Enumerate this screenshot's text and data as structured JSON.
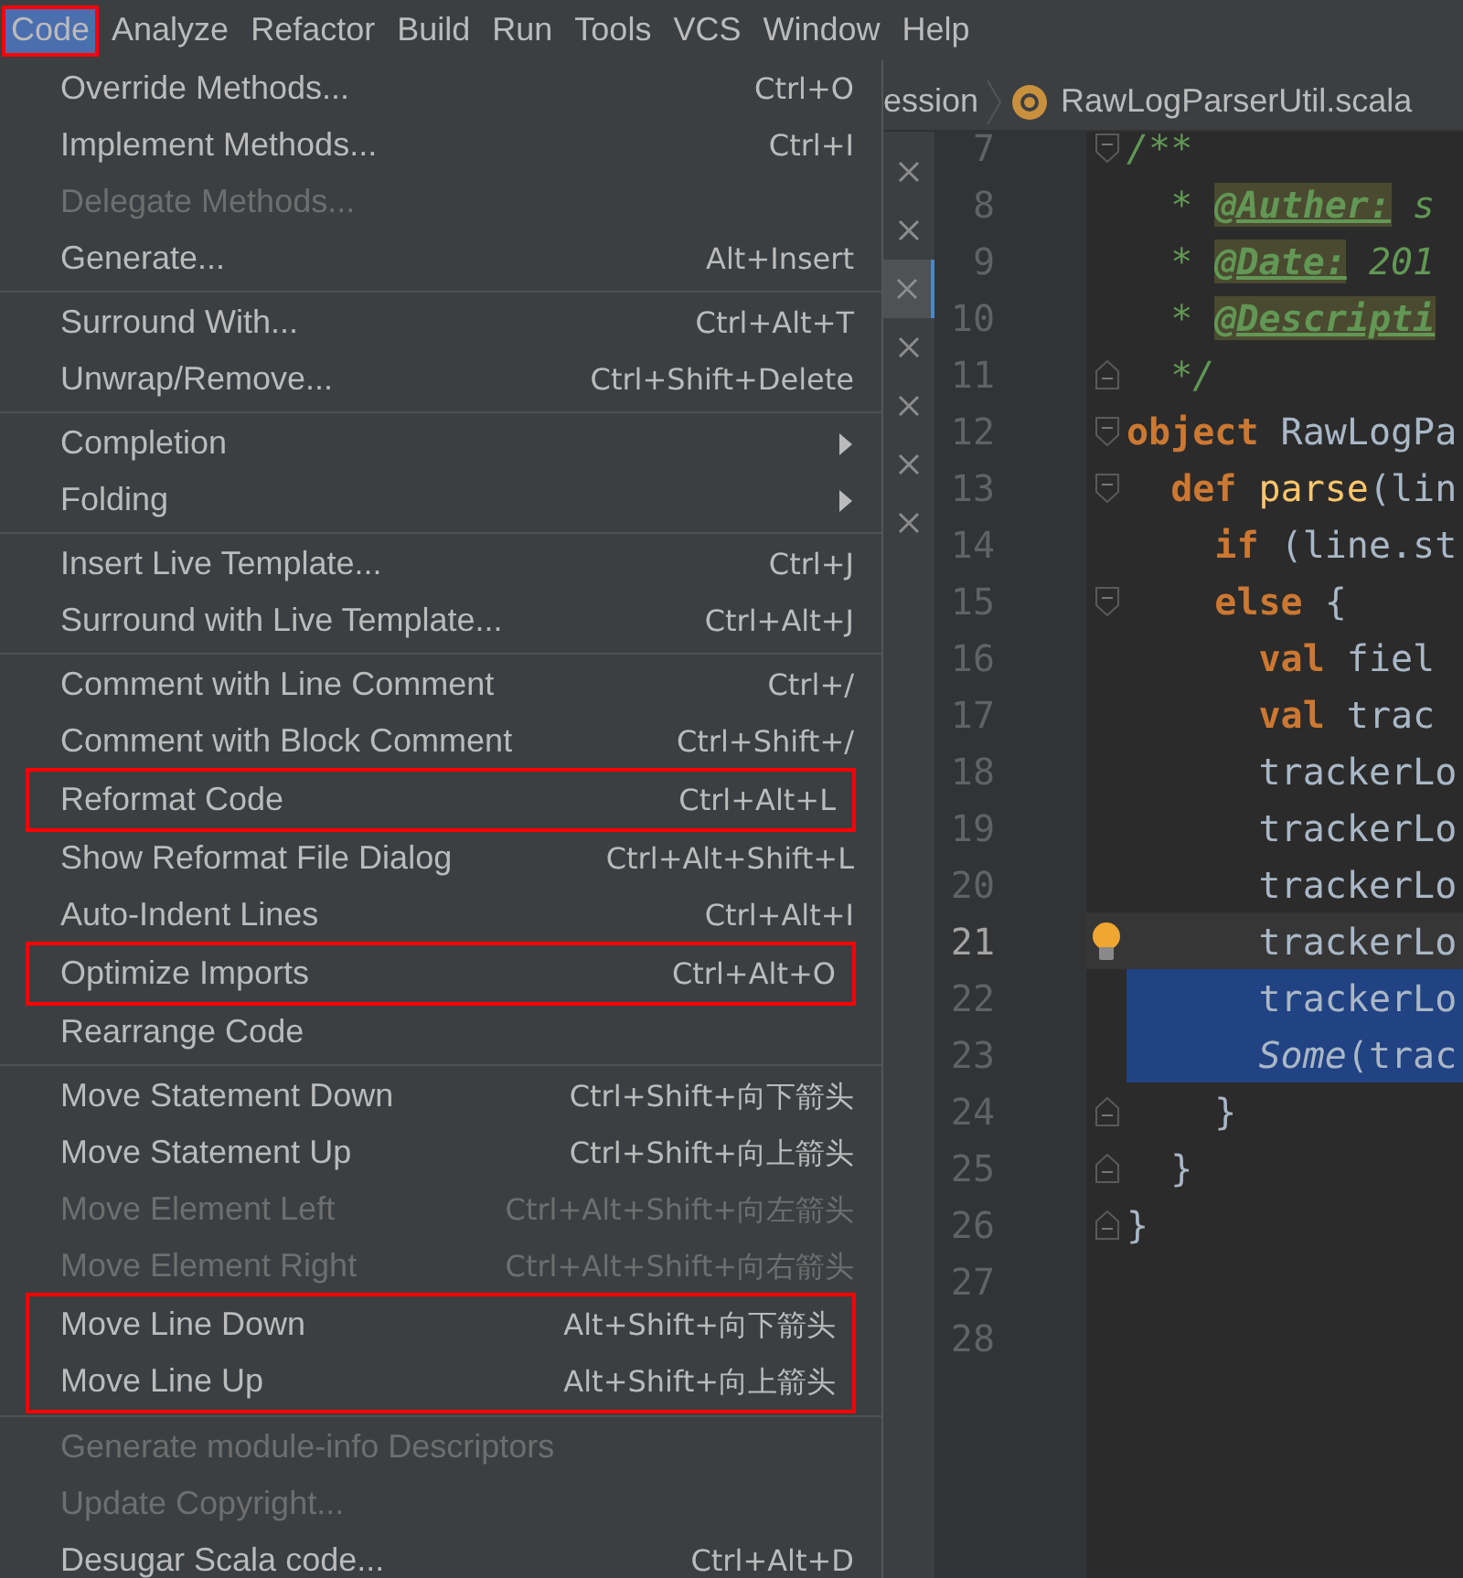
{
  "menubar": [
    {
      "label": "Code",
      "selected": true,
      "outlined": true
    },
    {
      "label": "Analyze",
      "selected": false,
      "outlined": false
    },
    {
      "label": "Refactor",
      "selected": false,
      "outlined": false
    },
    {
      "label": "Build",
      "selected": false,
      "outlined": false
    },
    {
      "label": "Run",
      "selected": false,
      "outlined": false
    },
    {
      "label": "Tools",
      "selected": false,
      "outlined": false
    },
    {
      "label": "VCS",
      "selected": false,
      "outlined": false
    },
    {
      "label": "Window",
      "selected": false,
      "outlined": false
    },
    {
      "label": "Help",
      "selected": false,
      "outlined": false
    }
  ],
  "menu": {
    "sections": [
      {
        "items": [
          {
            "label": "Override Methods...",
            "shortcut": "Ctrl+O",
            "disabled": false,
            "outlined": false,
            "submenu": false
          },
          {
            "label": "Implement Methods...",
            "shortcut": "Ctrl+I",
            "disabled": false,
            "outlined": false,
            "submenu": false
          },
          {
            "label": "Delegate Methods...",
            "disabled": true,
            "outlined": false,
            "submenu": false
          },
          {
            "label": "Generate...",
            "shortcut": "Alt+Insert",
            "disabled": false,
            "outlined": false,
            "submenu": false
          }
        ]
      },
      {
        "items": [
          {
            "label": "Surround With...",
            "shortcut": "Ctrl+Alt+T",
            "disabled": false,
            "outlined": false,
            "submenu": false
          },
          {
            "label": "Unwrap/Remove...",
            "shortcut": "Ctrl+Shift+Delete",
            "disabled": false,
            "outlined": false,
            "submenu": false
          }
        ]
      },
      {
        "items": [
          {
            "label": "Completion",
            "disabled": false,
            "outlined": false,
            "submenu": true
          },
          {
            "label": "Folding",
            "disabled": false,
            "outlined": false,
            "submenu": true
          }
        ]
      },
      {
        "items": [
          {
            "label": "Insert Live Template...",
            "shortcut": "Ctrl+J",
            "disabled": false,
            "outlined": false,
            "submenu": false
          },
          {
            "label": "Surround with Live Template...",
            "shortcut": "Ctrl+Alt+J",
            "disabled": false,
            "outlined": false,
            "submenu": false
          }
        ]
      },
      {
        "items": [
          {
            "label": "Comment with Line Comment",
            "shortcut": "Ctrl+/",
            "disabled": false,
            "outlined": false,
            "submenu": false
          },
          {
            "label": "Comment with Block Comment",
            "shortcut": "Ctrl+Shift+/",
            "disabled": false,
            "outlined": false,
            "submenu": false
          },
          {
            "label": "Reformat Code",
            "shortcut": "Ctrl+Alt+L",
            "disabled": false,
            "outlined": true,
            "submenu": false
          },
          {
            "label": "Show Reformat File Dialog",
            "shortcut": "Ctrl+Alt+Shift+L",
            "disabled": false,
            "outlined": false,
            "submenu": false
          },
          {
            "label": "Auto-Indent Lines",
            "shortcut": "Ctrl+Alt+I",
            "disabled": false,
            "outlined": false,
            "submenu": false
          },
          {
            "label": "Optimize Imports",
            "shortcut": "Ctrl+Alt+O",
            "disabled": false,
            "outlined": true,
            "submenu": false
          },
          {
            "label": "Rearrange Code",
            "disabled": false,
            "outlined": false,
            "submenu": false
          }
        ]
      },
      {
        "items": [
          {
            "label": "Move Statement Down",
            "shortcut": "Ctrl+Shift+向下箭头",
            "disabled": false,
            "outlined": false,
            "submenu": false
          },
          {
            "label": "Move Statement Up",
            "shortcut": "Ctrl+Shift+向上箭头",
            "disabled": false,
            "outlined": false,
            "submenu": false
          },
          {
            "label": "Move Element Left",
            "shortcut": "Ctrl+Alt+Shift+向左箭头",
            "disabled": true,
            "outlined": false,
            "submenu": false
          },
          {
            "label": "Move Element Right",
            "shortcut": "Ctrl+Alt+Shift+向右箭头",
            "disabled": true,
            "outlined": false,
            "submenu": false
          },
          {
            "label": "Move Line Down",
            "shortcut": "Alt+Shift+向下箭头",
            "disabled": false,
            "outlined": true,
            "submenu": false
          },
          {
            "label": "Move Line Up",
            "shortcut": "Alt+Shift+向上箭头",
            "disabled": false,
            "outlined": true,
            "submenu": false
          }
        ]
      },
      {
        "items": [
          {
            "label": "Generate module-info Descriptors",
            "disabled": true,
            "outlined": false,
            "submenu": false
          },
          {
            "label": "Update Copyright...",
            "disabled": true,
            "outlined": false,
            "submenu": false
          },
          {
            "label": "Desugar Scala code...",
            "shortcut": "Ctrl+Alt+D",
            "disabled": false,
            "outlined": false,
            "submenu": false
          }
        ]
      }
    ]
  },
  "breadcrumb": [
    {
      "text": "ession",
      "icon": false
    },
    {
      "text": "RawLogParserUtil.scala",
      "icon": true
    }
  ],
  "close_buttons": [
    {
      "selected": false
    },
    {
      "selected": false
    },
    {
      "selected": true
    },
    {
      "selected": false
    },
    {
      "selected": false
    },
    {
      "selected": false
    },
    {
      "selected": false
    }
  ],
  "editor": {
    "lines": [
      {
        "number": "7",
        "fold_start": true,
        "fold_end": false,
        "current": false,
        "selected": false,
        "bulb": false,
        "tokens": [
          {
            "text": "/**",
            "kind": "comment"
          }
        ]
      },
      {
        "number": "8",
        "fold_start": false,
        "fold_end": false,
        "current": false,
        "selected": false,
        "bulb": false,
        "tokens": [
          {
            "text": "  * ",
            "kind": "comment"
          },
          {
            "text": "@Auther:",
            "kind": "tag"
          },
          {
            "text": " s",
            "kind": "comment"
          }
        ]
      },
      {
        "number": "9",
        "fold_start": false,
        "fold_end": false,
        "current": false,
        "selected": false,
        "bulb": false,
        "tokens": [
          {
            "text": "  * ",
            "kind": "comment"
          },
          {
            "text": "@Date:",
            "kind": "tag"
          },
          {
            "text": " 201",
            "kind": "comment"
          }
        ]
      },
      {
        "number": "10",
        "fold_start": false,
        "fold_end": false,
        "current": false,
        "selected": false,
        "bulb": false,
        "tokens": [
          {
            "text": "  * ",
            "kind": "comment"
          },
          {
            "text": "@Descripti",
            "kind": "tag"
          }
        ]
      },
      {
        "number": "11",
        "fold_start": false,
        "fold_end": true,
        "current": false,
        "selected": false,
        "bulb": false,
        "tokens": [
          {
            "text": "  */",
            "kind": "comment"
          }
        ]
      },
      {
        "number": "12",
        "fold_start": true,
        "fold_end": false,
        "current": false,
        "selected": false,
        "bulb": false,
        "tokens": [
          {
            "text": "object",
            "kind": "keyword"
          },
          {
            "text": " RawLogPa",
            "kind": "plain"
          }
        ]
      },
      {
        "number": "13",
        "fold_start": true,
        "fold_end": false,
        "current": false,
        "selected": false,
        "bulb": false,
        "tokens": [
          {
            "text": "  def",
            "kind": "keyword"
          },
          {
            "text": " parse",
            "kind": "function"
          },
          {
            "text": "(lin",
            "kind": "plain"
          }
        ]
      },
      {
        "number": "14",
        "fold_start": false,
        "fold_end": false,
        "current": false,
        "selected": false,
        "bulb": false,
        "tokens": [
          {
            "text": "    if",
            "kind": "keyword"
          },
          {
            "text": " (line.st",
            "kind": "plain"
          }
        ]
      },
      {
        "number": "15",
        "fold_start": true,
        "fold_end": false,
        "current": false,
        "selected": false,
        "bulb": false,
        "tokens": [
          {
            "text": "    else",
            "kind": "keyword"
          },
          {
            "text": " {",
            "kind": "plain"
          }
        ]
      },
      {
        "number": "16",
        "fold_start": false,
        "fold_end": false,
        "current": false,
        "selected": false,
        "bulb": false,
        "tokens": [
          {
            "text": "      val",
            "kind": "keyword"
          },
          {
            "text": " fiel",
            "kind": "plain"
          }
        ]
      },
      {
        "number": "17",
        "fold_start": false,
        "fold_end": false,
        "current": false,
        "selected": false,
        "bulb": false,
        "tokens": [
          {
            "text": "      val",
            "kind": "keyword"
          },
          {
            "text": " trac",
            "kind": "plain"
          }
        ]
      },
      {
        "number": "18",
        "fold_start": false,
        "fold_end": false,
        "current": false,
        "selected": false,
        "bulb": false,
        "tokens": [
          {
            "text": "      trackerLo",
            "kind": "plain"
          }
        ]
      },
      {
        "number": "19",
        "fold_start": false,
        "fold_end": false,
        "current": false,
        "selected": false,
        "bulb": false,
        "tokens": [
          {
            "text": "      trackerLo",
            "kind": "plain"
          }
        ]
      },
      {
        "number": "20",
        "fold_start": false,
        "fold_end": false,
        "current": false,
        "selected": false,
        "bulb": false,
        "tokens": [
          {
            "text": "      trackerLo",
            "kind": "plain"
          }
        ]
      },
      {
        "number": "21",
        "fold_start": false,
        "fold_end": false,
        "current": true,
        "selected": false,
        "bulb": true,
        "tokens": [
          {
            "text": "      trackerLo",
            "kind": "plain"
          }
        ]
      },
      {
        "number": "22",
        "fold_start": false,
        "fold_end": false,
        "current": false,
        "selected": true,
        "bulb": false,
        "tokens": [
          {
            "text": "      trackerLo",
            "kind": "plain"
          }
        ]
      },
      {
        "number": "23",
        "fold_start": false,
        "fold_end": false,
        "current": false,
        "selected": true,
        "bulb": false,
        "tokens": [
          {
            "text": "      Some",
            "kind": "italic"
          },
          {
            "text": "(trac",
            "kind": "plain"
          }
        ]
      },
      {
        "number": "24",
        "fold_start": false,
        "fold_end": true,
        "current": false,
        "selected": false,
        "bulb": false,
        "tokens": [
          {
            "text": "    }",
            "kind": "plain"
          }
        ]
      },
      {
        "number": "25",
        "fold_start": false,
        "fold_end": true,
        "current": false,
        "selected": false,
        "bulb": false,
        "tokens": [
          {
            "text": "  }",
            "kind": "plain"
          }
        ]
      },
      {
        "number": "26",
        "fold_start": false,
        "fold_end": true,
        "current": false,
        "selected": false,
        "bulb": false,
        "tokens": [
          {
            "text": "}",
            "kind": "plain"
          }
        ]
      },
      {
        "number": "27",
        "fold_start": false,
        "fold_end": false,
        "current": false,
        "selected": false,
        "bulb": false
      },
      {
        "number": "28",
        "fold_start": false,
        "fold_end": false,
        "current": false,
        "selected": false,
        "bulb": false
      }
    ]
  }
}
